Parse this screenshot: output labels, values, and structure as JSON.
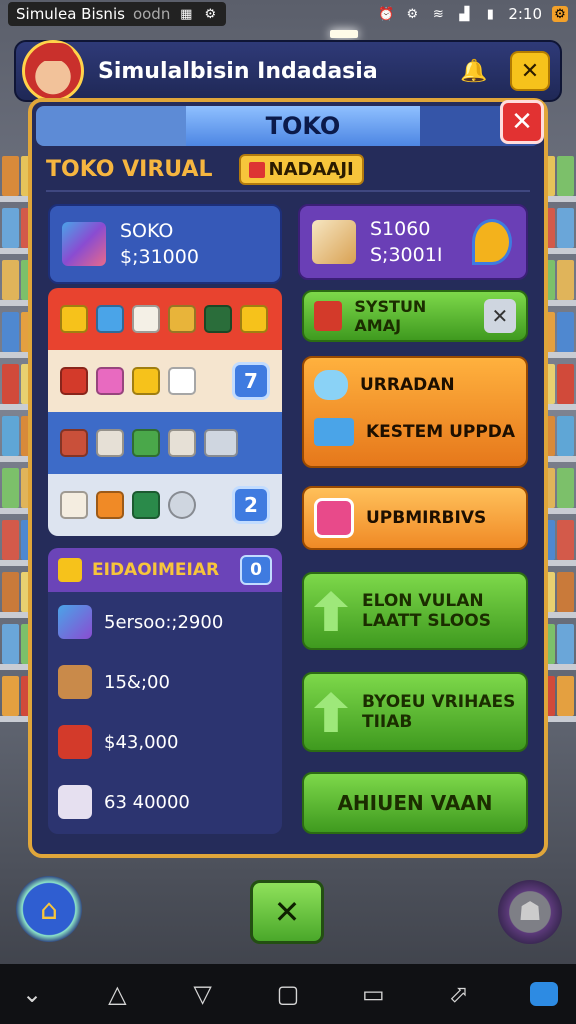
{
  "status_bar": {
    "app_title": "Simulea Bisnis",
    "app_sub": "oodn",
    "time": "2:10"
  },
  "header": {
    "title": "Simulalbisin Indadasia"
  },
  "panel": {
    "tab_label": "TOKO",
    "subtitle": "TOKO VIRUAL",
    "badge_label": "NADAAJI"
  },
  "cards": [
    {
      "line1": "SOKO",
      "line2": "$;31000"
    },
    {
      "line1": "S1060",
      "line2": "S;3001I"
    }
  ],
  "grid_counts": [
    "7",
    "2"
  ],
  "buttons": [
    {
      "label": "SYSTUN AMAJ"
    },
    {
      "label1": "URRADAN",
      "label2": "KESTEM UPPDA"
    },
    {
      "label": "UPBMIRBIVS"
    },
    {
      "label1": "ELON VULAN",
      "label2": "LAATT SLOOS"
    },
    {
      "label1": "BYOEU VRIHAES",
      "label2": "TIIAB"
    },
    {
      "label": "AHIUEN VAAN"
    }
  ],
  "list": {
    "header": "EIDAOIMEIAR",
    "badge": "0",
    "items": [
      {
        "text": "5ersoo:;2900"
      },
      {
        "text": "15&;00"
      },
      {
        "text": "$43,000"
      },
      {
        "text": "63 40000"
      }
    ]
  },
  "colors": {
    "accent_gold": "#e0a63a",
    "panel_bg": "#252c5a",
    "close_red": "#e23232",
    "green_btn": "#4aa82a",
    "orange_btn": "#e6781b"
  }
}
